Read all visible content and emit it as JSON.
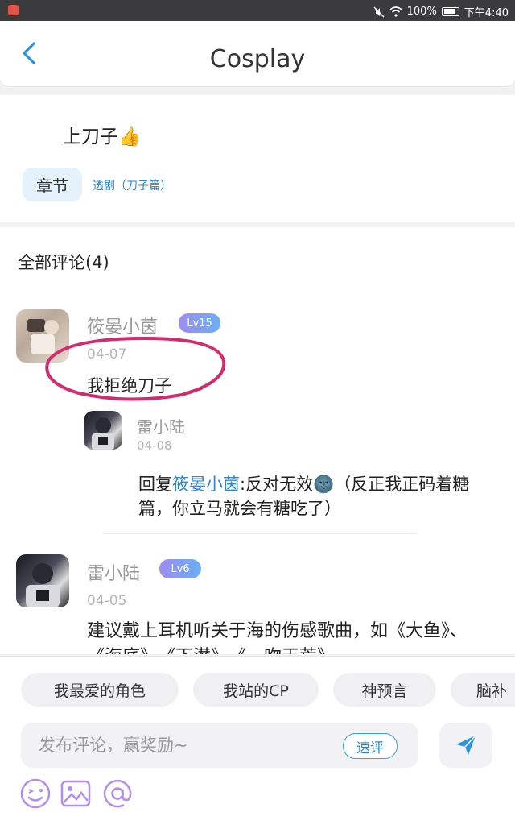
{
  "status_bar": {
    "battery": "100%",
    "time": "下午4:40"
  },
  "header": {
    "title": "Cosplay"
  },
  "post": {
    "text": "上刀子👍",
    "chapter_tag": "章节",
    "chapter_link": "透剧（刀子篇）"
  },
  "comments": {
    "title": "全部评论(4)",
    "items": [
      {
        "username": "筱晏小茵",
        "level": "Lv15",
        "date": "04-07",
        "text": "我拒绝刀子"
      },
      {
        "username": "雷小陆",
        "level": "Lv6",
        "date": "04-05",
        "text": "建议戴上耳机听关于海的伤感歌曲，如《大鱼》、《海底》、《下潜》、《一吻天荒》"
      }
    ],
    "reply": {
      "username": "雷小陆",
      "date": "04-08",
      "prefix": "回复",
      "target": "筱晏小茵",
      "line1": ":反对无效🌚（反正我正码着糖",
      "line2": "篇，你立马就会有糖吃了）"
    }
  },
  "bottom": {
    "chips": [
      "我最爱的角色",
      "我站的CP",
      "神预言",
      "脑补"
    ],
    "input_placeholder": "发布评论，赢奖励~",
    "quick_comment": "速评"
  },
  "colors": {
    "accent": "#2a86d8",
    "highlight_circle": "#d42a6e",
    "level_badge": "#8c9cf2"
  }
}
